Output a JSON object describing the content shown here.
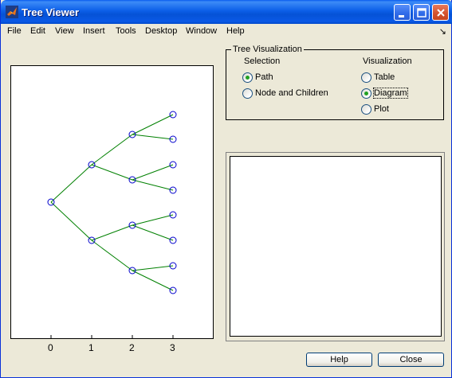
{
  "window": {
    "title": "Tree Viewer"
  },
  "menu": {
    "items": [
      "File",
      "Edit",
      "View",
      "Insert",
      "Tools",
      "Desktop",
      "Window",
      "Help"
    ],
    "overflow_glyph": "↘"
  },
  "plot": {
    "x_ticks": [
      "0",
      "1",
      "2",
      "3"
    ],
    "node_color": "#0000cc",
    "edge_color": "#008000"
  },
  "tree_visualization": {
    "title": "Tree Visualization",
    "selection": {
      "heading": "Selection",
      "options": [
        "Path",
        "Node and Children"
      ],
      "selected": "Path"
    },
    "visualization": {
      "heading": "Visualization",
      "options": [
        "Table",
        "Diagram",
        "Plot"
      ],
      "selected": "Diagram"
    }
  },
  "buttons": {
    "help_label": "Help",
    "close_label": "Close"
  }
}
